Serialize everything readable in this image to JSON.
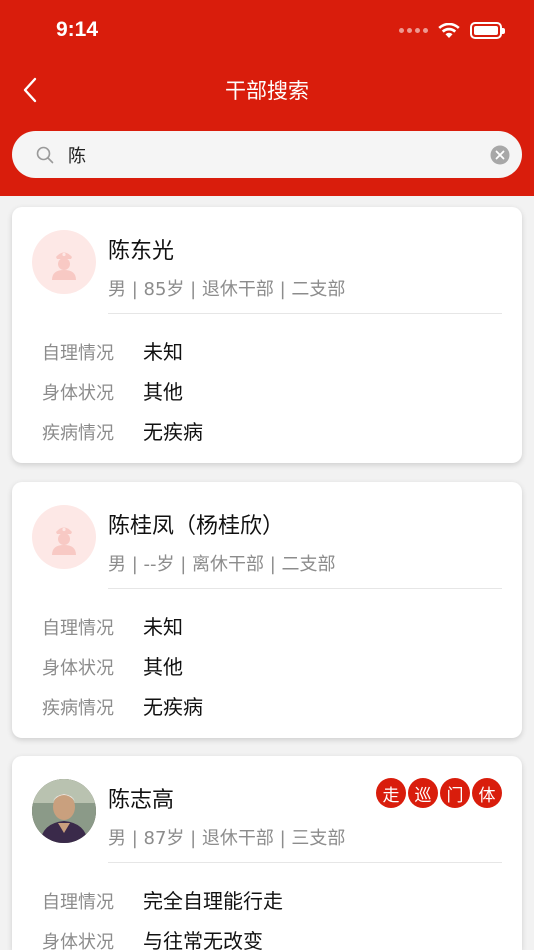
{
  "status_bar": {
    "time": "9:14"
  },
  "nav": {
    "title": "干部搜索"
  },
  "search": {
    "value": "陈"
  },
  "colors": {
    "primary": "#d91d0c",
    "avatar_bg": "#fde8e6"
  },
  "labels": {
    "self_care": "自理情况",
    "physical": "身体状况",
    "disease": "疾病情况"
  },
  "cards": [
    {
      "name": "陈东光",
      "meta": "男 | 85岁 | 退休干部 | 二支部",
      "self_care": "未知",
      "physical": "其他",
      "disease": "无疾病",
      "avatar": "default-avatar-icon"
    },
    {
      "name": "陈桂凤（杨桂欣）",
      "meta": "男 | --岁 | 离休干部 | 二支部",
      "self_care": "未知",
      "physical": "其他",
      "disease": "无疾病",
      "avatar": "default-avatar-icon"
    },
    {
      "name": "陈志高",
      "meta": "男 | 87岁 | 退休干部 | 三支部",
      "self_care": "完全自理能行走",
      "physical": "与往常无改变",
      "avatar": "photo-avatar",
      "badges": [
        "走",
        "巡",
        "门",
        "体"
      ]
    }
  ]
}
